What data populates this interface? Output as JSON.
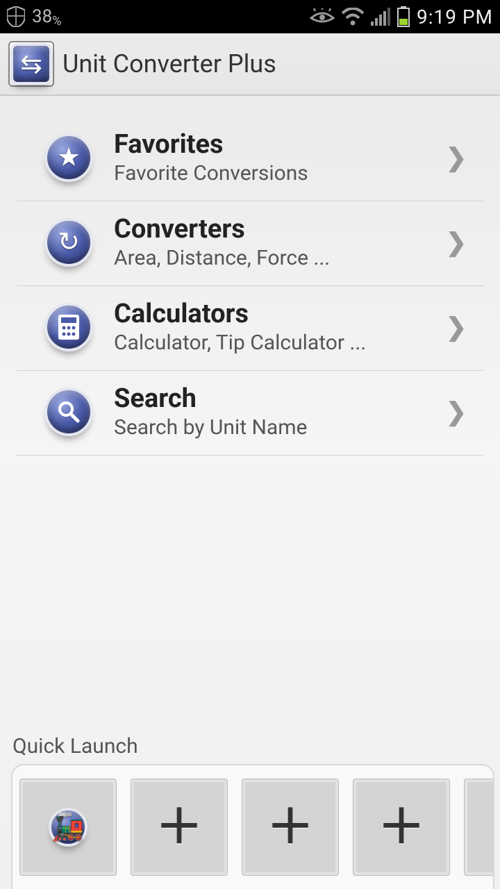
{
  "status": {
    "battery_percent": "38",
    "time": "9:19 PM"
  },
  "app": {
    "title": "Unit Converter Plus"
  },
  "menu": [
    {
      "icon": "star",
      "title": "Favorites",
      "subtitle": "Favorite Conversions"
    },
    {
      "icon": "refresh",
      "title": "Converters",
      "subtitle": "Area, Distance, Force ..."
    },
    {
      "icon": "calculator",
      "title": "Calculators",
      "subtitle": "Calculator, Tip Calculator ..."
    },
    {
      "icon": "search",
      "title": "Search",
      "subtitle": "Search by Unit Name"
    }
  ],
  "quick_launch": {
    "label": "Quick Launch",
    "tiles": [
      {
        "type": "app",
        "icon": "robot"
      },
      {
        "type": "add"
      },
      {
        "type": "add"
      },
      {
        "type": "add"
      },
      {
        "type": "add"
      }
    ]
  }
}
